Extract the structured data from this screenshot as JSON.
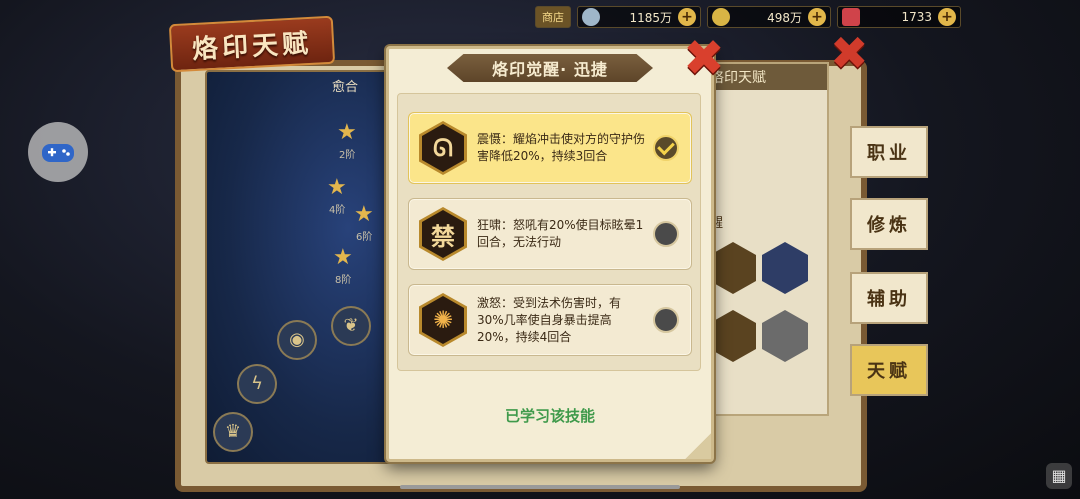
{
  "topbar": {
    "shop_label": "商店",
    "silver": "1185万",
    "gold": "498万",
    "gems": "1733"
  },
  "background": {
    "title": "烙印天赋",
    "starmap_title": "愈合",
    "right_panel_header": "烙印天赋",
    "right_panel_sub": "醒",
    "star_labels": [
      "2阶",
      "4阶",
      "6阶",
      "8阶"
    ]
  },
  "side_tabs": [
    {
      "label": "职业"
    },
    {
      "label": "修炼"
    },
    {
      "label": "辅助"
    },
    {
      "label": "天赋"
    }
  ],
  "modal": {
    "title": "烙印觉醒· 迅捷",
    "options": [
      {
        "icon": "ᘏ",
        "text": "震慑：耀焰冲击使对方的守护伤害降低20%，持续3回合",
        "selected": true
      },
      {
        "icon": "禁",
        "text": "狂啸：怒吼有20%使目标眩晕1回合，无法行动",
        "selected": false
      },
      {
        "icon": "✺",
        "text": "激怒：受到法术伤害时，有30%几率使自身暴击提高20%，持续4回合",
        "selected": false
      }
    ],
    "status": "已学习该技能"
  },
  "colors": {
    "selected_option": "#fbe58a",
    "learned_text": "#3f9a4b",
    "close_x": "#d9402d"
  }
}
